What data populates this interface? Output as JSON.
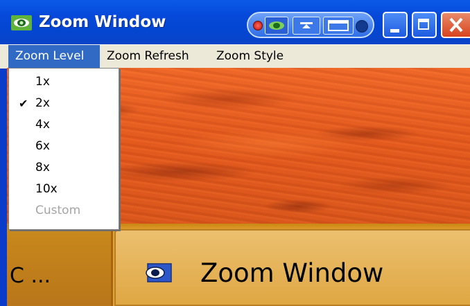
{
  "window": {
    "title": "Zoom Window",
    "colors": {
      "title_bar": "#0a4ad4",
      "menu_bg": "#ece9d8",
      "menu_highlight": "#316ac5"
    }
  },
  "title_bar": {
    "icon": "nvidia-eye-icon",
    "controls": {
      "minimize": "minimize-icon",
      "maximize": "maximize-icon",
      "close": "close-icon"
    }
  },
  "menubar": {
    "items": [
      {
        "label": "Zoom Level",
        "active": true
      },
      {
        "label": "Zoom Refresh",
        "active": false
      },
      {
        "label": "Zoom Style",
        "active": false
      }
    ]
  },
  "dropdown": {
    "items": [
      {
        "label": "1x",
        "checked": false,
        "disabled": false
      },
      {
        "label": "2x",
        "checked": true,
        "disabled": false
      },
      {
        "label": "4x",
        "checked": false,
        "disabled": false
      },
      {
        "label": "6x",
        "checked": false,
        "disabled": false
      },
      {
        "label": "8x",
        "checked": false,
        "disabled": false
      },
      {
        "label": "10x",
        "checked": false,
        "disabled": false
      },
      {
        "label": "Custom",
        "checked": false,
        "disabled": true
      }
    ],
    "check_glyph": "✔"
  },
  "taskbar": {
    "left_text": "C ...",
    "button_text": "Zoom Window",
    "button_icon": "nvidia-eye-icon"
  }
}
